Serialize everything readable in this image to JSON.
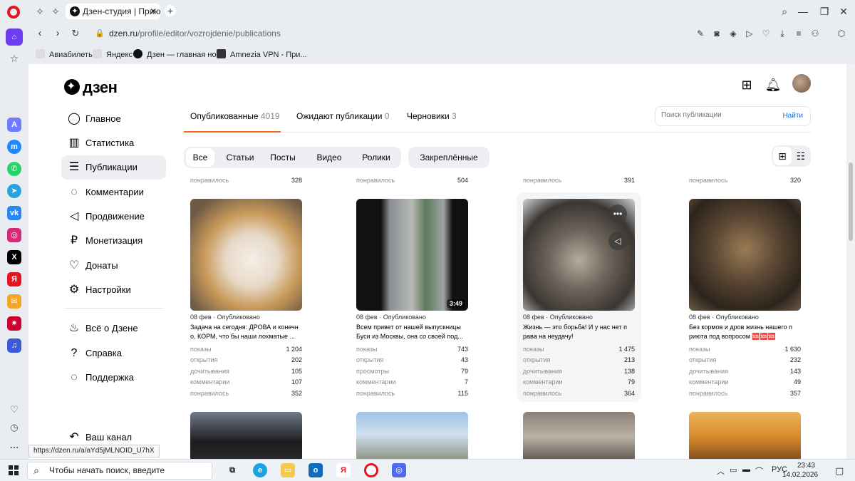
{
  "browser": {
    "tab_title": "Дзен-студия | Приют Пла",
    "url_host": "dzen.ru",
    "url_path": "/profile/editor/vozrojdenie/publications",
    "bookmarks": [
      "Авиабилеты",
      "Яндекс",
      "Дзен — главная но...",
      "Amnezia VPN - При..."
    ],
    "status_url": "https://dzen.ru/a/aYd5jMLNOID_U7hX"
  },
  "logo": "дзен",
  "nav": {
    "items": [
      "Главное",
      "Статистика",
      "Публикации",
      "Комментарии",
      "Продвижение",
      "Монетизация",
      "Донаты",
      "Настройки"
    ],
    "secondary": [
      "Всё о Дзене",
      "Справка",
      "Поддержка"
    ],
    "channel": "Ваш канал"
  },
  "pub_tabs": [
    {
      "label": "Опубликованные",
      "count": "4019"
    },
    {
      "label": "Ожидают публикации",
      "count": "0"
    },
    {
      "label": "Черновики",
      "count": "3"
    }
  ],
  "search": {
    "placeholder": "Поиск публикации",
    "button": "Найти"
  },
  "filters": [
    "Все",
    "Статьи",
    "Посты",
    "Видео",
    "Ролики"
  ],
  "pinned": "Закреплённые",
  "top_row": {
    "label": "понравилось",
    "values": [
      "328",
      "504",
      "391",
      "320"
    ]
  },
  "cards": [
    {
      "date": "08 фев · Опубликовано",
      "title": "Задача на сегодня: ДРОВА и конечн о, КОРМ, что бы наши лохматые ...",
      "stats": [
        [
          "показы",
          "1 204"
        ],
        [
          "открытия",
          "202"
        ],
        [
          "дочитывания",
          "105"
        ],
        [
          "комментарии",
          "107"
        ],
        [
          "понравилось",
          "352"
        ]
      ]
    },
    {
      "date": "08 фев · Опубликовано",
      "title": "Всем привет от нашей выпускницы Буси из Москвы, она со своей под...",
      "duration": "3:49",
      "stats": [
        [
          "показы",
          "743"
        ],
        [
          "открытия",
          "43"
        ],
        [
          "просмотры",
          "79"
        ],
        [
          "комментарии",
          "7"
        ],
        [
          "понравилось",
          "115"
        ]
      ]
    },
    {
      "date": "08 фев · Опубликовано",
      "title": "Жизнь — это борьба! И у нас нет п рава на неудачу!",
      "stats": [
        [
          "показы",
          "1 475"
        ],
        [
          "открытия",
          "213"
        ],
        [
          "дочитывания",
          "138"
        ],
        [
          "комментарии",
          "79"
        ],
        [
          "понравилось",
          "364"
        ]
      ]
    },
    {
      "date": "08 фев · Опубликовано",
      "title": "Без кормов и дров жизнь нашего п риюта под вопросом 🆘🆘🆘",
      "stats": [
        [
          "показы",
          "1 630"
        ],
        [
          "открытия",
          "232"
        ],
        [
          "дочитывания",
          "143"
        ],
        [
          "комментарии",
          "49"
        ],
        [
          "понравилось",
          "357"
        ]
      ]
    }
  ],
  "taskbar": {
    "search_placeholder": "Чтобы начать поиск, введите",
    "lang": "РУС",
    "time": "23:43",
    "date": "14.02.2026"
  },
  "colors": {
    "accent": "#f36b21",
    "link": "#1a73e8",
    "opera_red": "#e5141f"
  }
}
